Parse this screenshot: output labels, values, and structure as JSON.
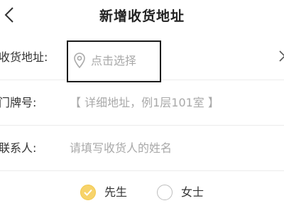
{
  "header": {
    "title": "新增收货地址",
    "back_icon": "chevron-left-icon"
  },
  "form": {
    "address": {
      "label": "收货地址:",
      "placeholder": "点击选择",
      "icon": "location-pin-icon",
      "arrow_icon": "chevron-right-icon"
    },
    "door_number": {
      "label": "门牌号:",
      "placeholder": "【 详细地址，例1层101室 】"
    },
    "contact": {
      "label": "联系人:",
      "placeholder": "请填写收货人的姓名"
    },
    "gender": {
      "options": [
        {
          "label": "先生",
          "selected": true
        },
        {
          "label": "女士",
          "selected": false
        }
      ],
      "selected_color": "#f7d36b"
    }
  }
}
